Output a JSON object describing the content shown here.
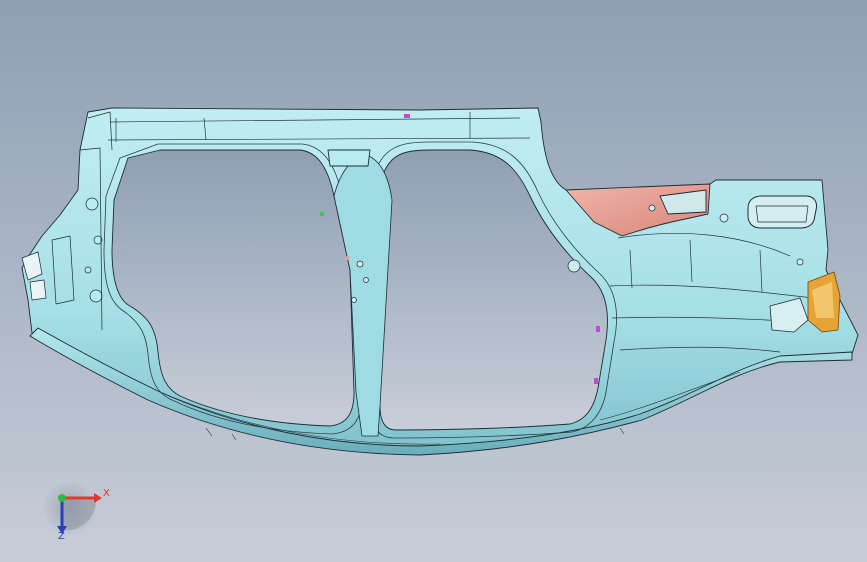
{
  "viewport": {
    "background_top": "#8f9fb4",
    "background_bottom": "#c7cdd7",
    "part_fill": "#aee6ec",
    "part_fill_dark": "#6fb4c2",
    "part_edge": "#1d2c33",
    "trim_fill": "#e8a195",
    "bracket_fill": "#e7a335"
  },
  "triad": {
    "x_label": "X",
    "y_label": "Z",
    "x_color": "#e23a2a",
    "y_color": "#2a3fb8",
    "origin_color": "#2fb84a"
  }
}
